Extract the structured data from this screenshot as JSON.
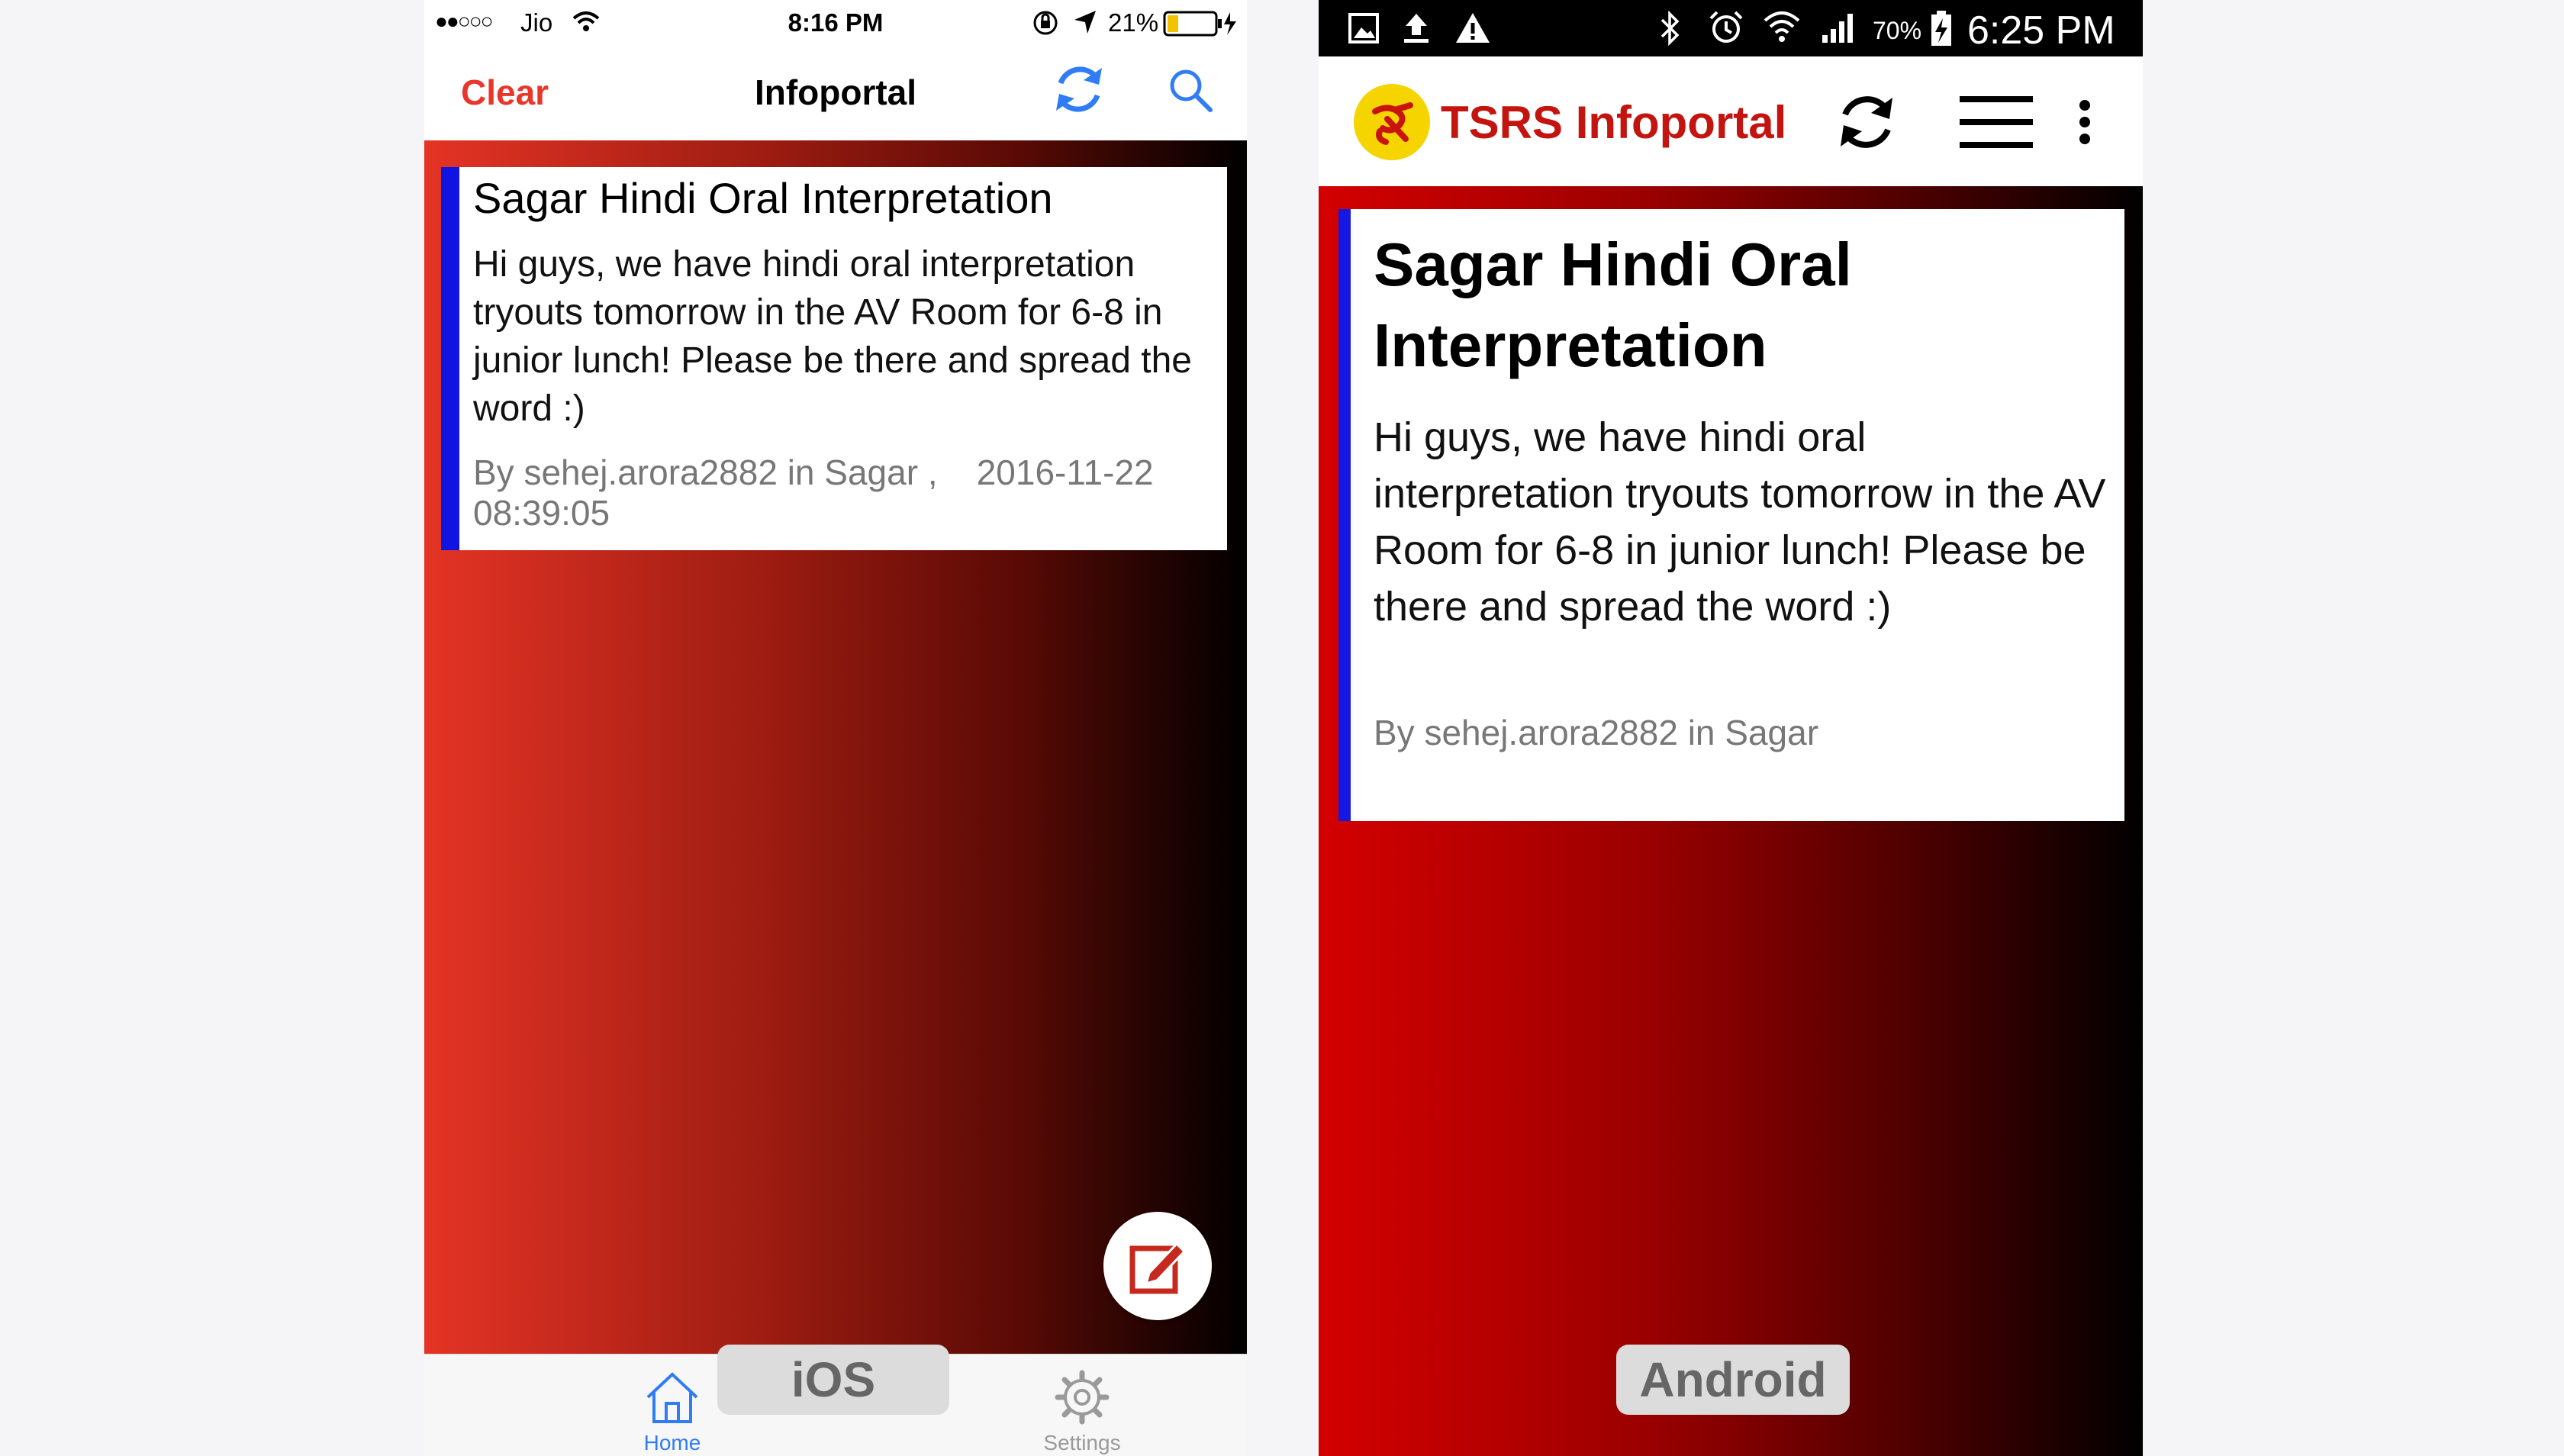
{
  "ios": {
    "status": {
      "signal": "●●○○○",
      "carrier": "Jio",
      "time": "8:16 PM",
      "battery_percent": "21%"
    },
    "nav": {
      "clear_label": "Clear",
      "title": "Infoportal",
      "refresh_icon": "refresh-icon",
      "search_icon": "search-icon"
    },
    "post": {
      "title": "Sagar Hindi Oral Interpretation",
      "body": "Hi guys, we have hindi oral interpretation tryouts tomorrow in the AV Room for 6-8 in junior lunch! Please be there and spread the word :)",
      "meta": "By sehej.arora2882 in Sagar ,    2016-11-22 08:39:05"
    },
    "fab_icon": "compose-icon",
    "tabs": [
      {
        "label": "Home",
        "icon": "home-icon"
      },
      {
        "label": "Settings",
        "icon": "gear-icon"
      }
    ],
    "platform_label": "iOS",
    "colors": {
      "accent_red": "#e8372a",
      "ios_blue": "#2f7cf6",
      "card_stripe": "#1014e0"
    }
  },
  "android": {
    "status": {
      "battery_percent": "70%",
      "time": "6:25 PM"
    },
    "appbar": {
      "title": "TSRS Infoportal",
      "refresh_icon": "refresh-icon",
      "menu_icon": "hamburger-icon",
      "overflow_icon": "more-vert-icon"
    },
    "post": {
      "title": "Sagar Hindi Oral Interpretation",
      "body": "Hi guys, we have hindi oral interpretation tryouts tomorrow in the AV Room for 6-8 in junior lunch! Please be there and spread the word :)",
      "meta": "By sehej.arora2882 in Sagar"
    },
    "platform_label": "Android",
    "colors": {
      "title_red": "#c3140f",
      "card_stripe": "#1418e0"
    }
  }
}
